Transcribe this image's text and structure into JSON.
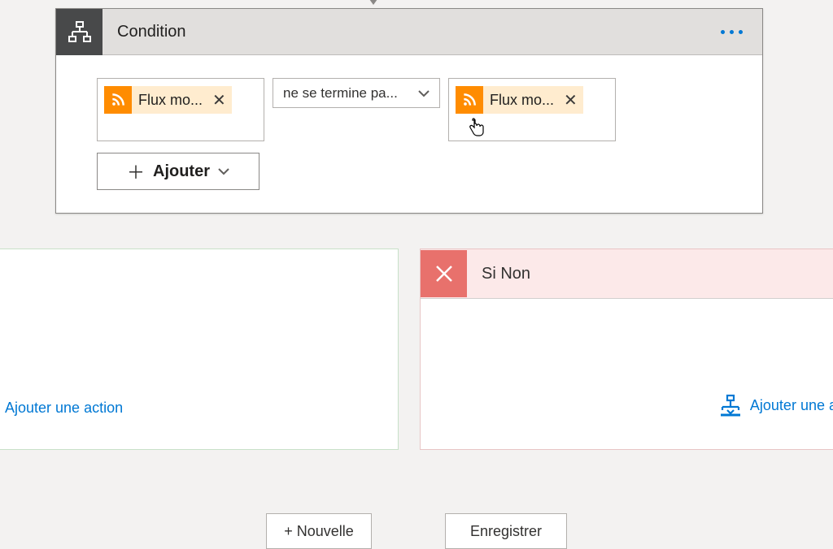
{
  "condition": {
    "title": "Condition",
    "operand1_label": "Flux mo...",
    "operator_label": "ne se termine pa...",
    "operand2_label": "Flux mo...",
    "add_label": "Ajouter"
  },
  "branches": {
    "no_title": "Si Non",
    "add_action_yes": "Ajouter une action",
    "add_action_no": "Ajouter une actio"
  },
  "footer": {
    "new_label": "+ Nouvelle",
    "save_label": "Enregistrer"
  }
}
